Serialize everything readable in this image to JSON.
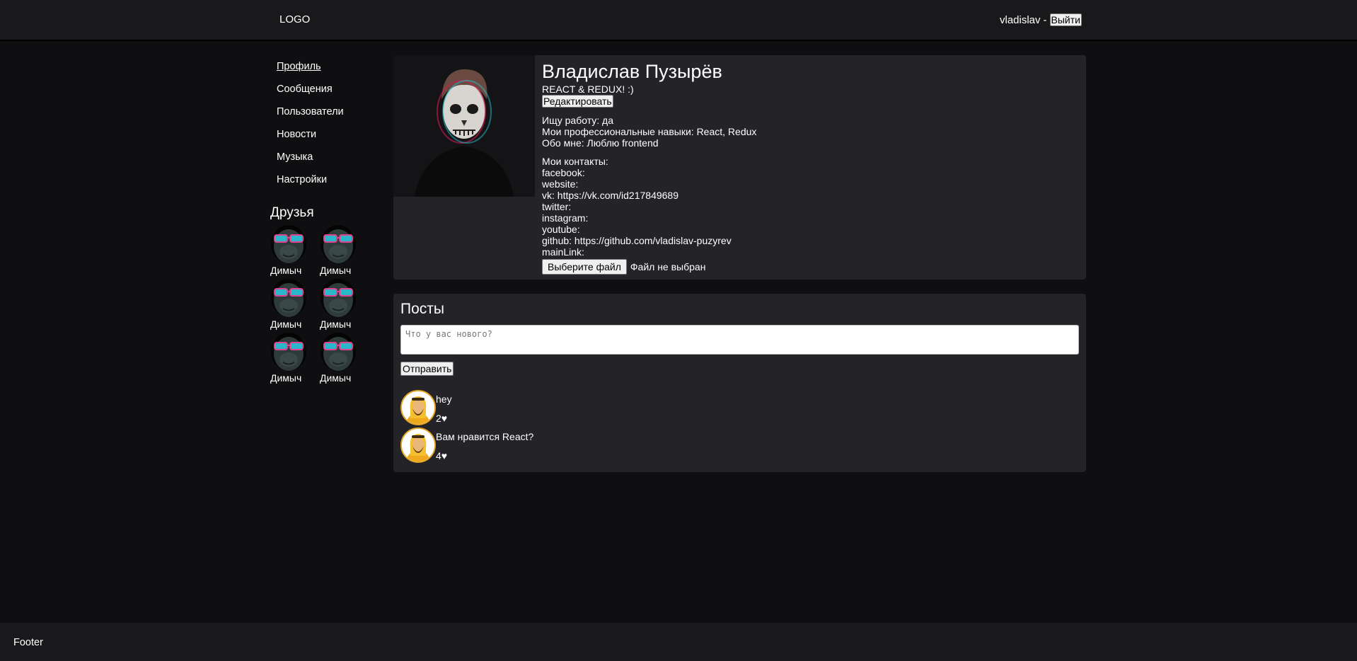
{
  "header": {
    "logo": "LOGO",
    "username": "vladislav",
    "separator": "-",
    "logout_label": "Выйти"
  },
  "nav": {
    "items": [
      {
        "label": "Профиль"
      },
      {
        "label": "Сообщения"
      },
      {
        "label": "Пользователи"
      },
      {
        "label": "Новости"
      },
      {
        "label": "Музыка"
      },
      {
        "label": "Настройки"
      }
    ]
  },
  "friends": {
    "title": "Друзья",
    "list": [
      {
        "name": "Димыч"
      },
      {
        "name": "Димыч"
      },
      {
        "name": "Димыч"
      },
      {
        "name": "Димыч"
      },
      {
        "name": "Димыч"
      },
      {
        "name": "Димыч"
      }
    ]
  },
  "profile": {
    "full_name": "Владислав Пузырёв",
    "status": "REACT & REDUX! :)",
    "edit_label": "Редактировать",
    "looking_for_job": "Ищу работу: да",
    "skills": "Мои профессиональные навыки: React, Redux",
    "about": "Обо мне: Люблю frontend",
    "contacts_title": "Мои контакты:",
    "contacts": [
      {
        "text": "facebook:"
      },
      {
        "text": "website:"
      },
      {
        "text": "vk: https://vk.com/id217849689"
      },
      {
        "text": "twitter:"
      },
      {
        "text": "instagram:"
      },
      {
        "text": "youtube:"
      },
      {
        "text": "github: https://github.com/vladislav-puzyrev"
      },
      {
        "text": "mainLink:"
      }
    ],
    "file_button_label": "Выберите файл",
    "file_status": "Файл не выбран"
  },
  "posts": {
    "title": "Посты",
    "input_placeholder": "Что у вас нового?",
    "send_label": "Отправить",
    "items": [
      {
        "text": "hey",
        "likes": "2♥"
      },
      {
        "text": "Вам нравится React?",
        "likes": "4♥"
      }
    ]
  },
  "footer": {
    "text": "Footer"
  },
  "colors": {
    "background": "#0f0f11",
    "header": "#19191b",
    "panel": "#232328",
    "text": "#ffffff",
    "avatar_ring": "#e2a524"
  }
}
